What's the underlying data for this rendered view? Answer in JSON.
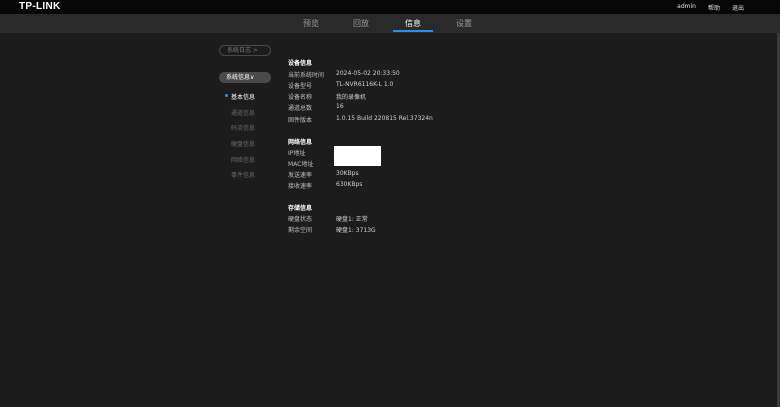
{
  "header": {
    "logo": "TP-LINK",
    "links": [
      "admin",
      "帮助",
      "退出"
    ]
  },
  "nav": {
    "tabs": [
      "预览",
      "回放",
      "信息",
      "设置"
    ],
    "active": "信息"
  },
  "sidebar": {
    "log_label": "系统日志 >",
    "sys_label": "系统信息∨",
    "items": [
      "基本信息",
      "通道信息",
      "码流信息",
      "硬盘信息",
      "网络信息",
      "事件信息"
    ],
    "active": "基本信息"
  },
  "device": {
    "title": "设备信息",
    "rows": [
      {
        "label": "当前系统时间",
        "value": "2024-05-02 20:33:50"
      },
      {
        "label": "设备型号",
        "value": "TL-NVR6116K-L 1.0"
      },
      {
        "label": "设备名称",
        "value": "我的录像机"
      },
      {
        "label": "通道总数",
        "value": "16"
      },
      {
        "label": "固件版本",
        "value": "1.0.15 Build 220815 Rel.37324n"
      }
    ]
  },
  "network": {
    "title": "网络信息",
    "rows": [
      {
        "label": "IP地址",
        "value": ""
      },
      {
        "label": "MAC地址",
        "value": ""
      },
      {
        "label": "发送速率",
        "value": "30KBps"
      },
      {
        "label": "接收速率",
        "value": "630KBps"
      }
    ]
  },
  "storage": {
    "title": "存储信息",
    "rows": [
      {
        "label": "硬盘状态",
        "value": "硬盘1: 正常"
      },
      {
        "label": "剩余空间",
        "value": "硬盘1: 3713G"
      }
    ]
  }
}
